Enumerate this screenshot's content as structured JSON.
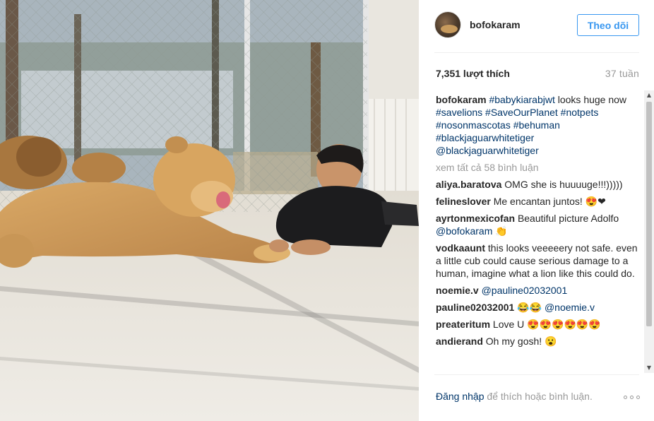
{
  "post": {
    "username": "bofokaram",
    "follow_label": "Theo dõi",
    "likes": "7,351 lượt thích",
    "age": "37 tuần"
  },
  "caption": {
    "user": "bofokaram",
    "tags_line1": "#babykiarabjwt",
    "text_line1": " looks huge now ",
    "tags": [
      "#savelions",
      "#SaveOurPlanet",
      "#notpets",
      "#nosonmascotas",
      "#behuman",
      "#blackjaguarwhitetiger"
    ],
    "mention": "@blackjaguarwhitetiger"
  },
  "view_all": "xem tất cả 58 bình luận",
  "comments": [
    {
      "user": "aliya.baratova",
      "text": "OMG she is huuuuge!!!)))))"
    },
    {
      "user": "felineslover",
      "text": "Me encantan juntos! 😍❤"
    },
    {
      "user": "ayrtonmexicofan",
      "text": "Beautiful picture Adolfo ",
      "mention": "@bofokaram",
      "tail": " 👏"
    },
    {
      "user": "vodkaaunt",
      "text": "this looks veeeeery not safe. even a little cub could cause serious damage to a human, imagine what a lion like this could do."
    },
    {
      "user": "noemie.v",
      "text": "",
      "mention": "@pauline02032001",
      "tail": ""
    },
    {
      "user": "pauline02032001",
      "text": "😂😂 ",
      "mention": "@noemie.v",
      "tail": ""
    },
    {
      "user": "preateritum",
      "text": "Love U 😍😍😍😍😍😍"
    },
    {
      "user": "andierand",
      "text": "Oh my gosh! 😮"
    }
  ],
  "footer": {
    "login": "Đăng nhập",
    "rest": " để thích hoặc bình luận."
  },
  "colors": {
    "follow_blue": "#3897f0",
    "link_blue": "#003569",
    "muted": "#999999"
  },
  "icons": {
    "more": "more-options-icon",
    "scroll_up": "scroll-up-arrow-icon",
    "scroll_down": "scroll-down-arrow-icon"
  }
}
